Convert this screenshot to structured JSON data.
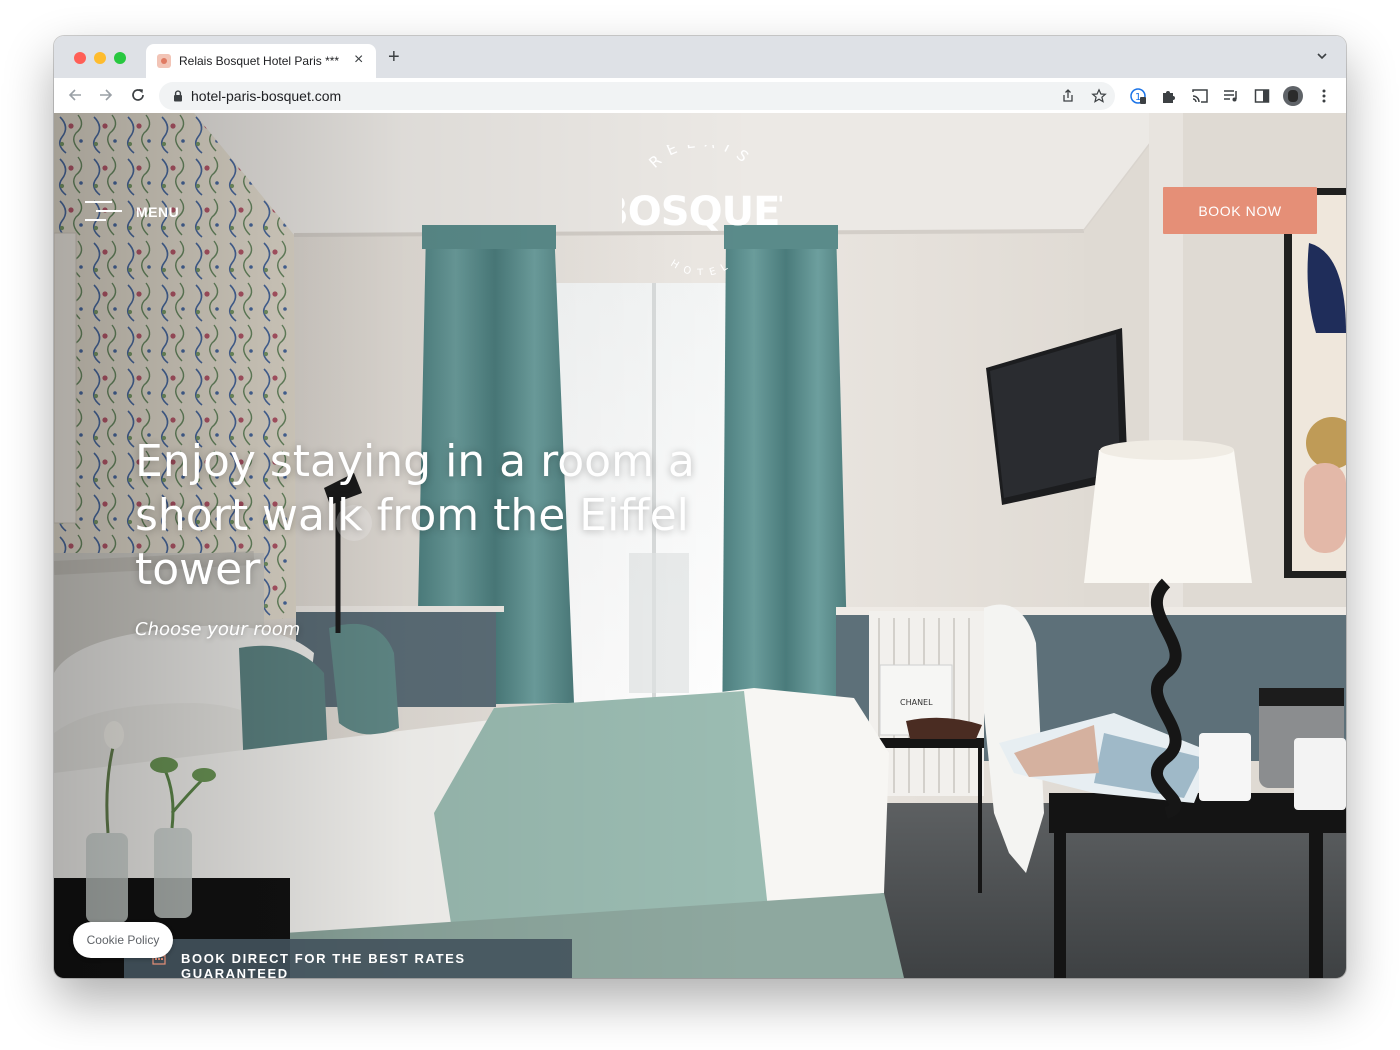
{
  "browser": {
    "tab_title": "Relais Bosquet Hotel Paris ***",
    "url": "hotel-paris-bosquet.com"
  },
  "site": {
    "menu_label": "MENU",
    "logo": {
      "arc_top": "RELAIS",
      "wordmark": "BOSQUET",
      "arc_bottom": "HOTEL"
    },
    "book_now_label": "BOOK NOW",
    "hero": {
      "headline": "Enjoy staying in a room a short walk from the Eiffel tower",
      "subline": "Choose your room"
    },
    "promo_text": "BOOK DIRECT FOR THE BEST RATES GUARANTEED",
    "cookie_label": "Cookie Policy"
  },
  "colors": {
    "accent": "#e58f77",
    "promo_bar": "#43525c",
    "curtain": "#5e9190",
    "wall": "#e8e3dc"
  },
  "icons": [
    "back-icon",
    "forward-icon",
    "reload-icon",
    "lock-icon",
    "share-icon",
    "star-icon",
    "extension-icon",
    "puzzle-icon",
    "cast-icon",
    "media-icon",
    "sidepanel-icon",
    "more-icon",
    "hamburger-icon",
    "calendar-icon"
  ]
}
